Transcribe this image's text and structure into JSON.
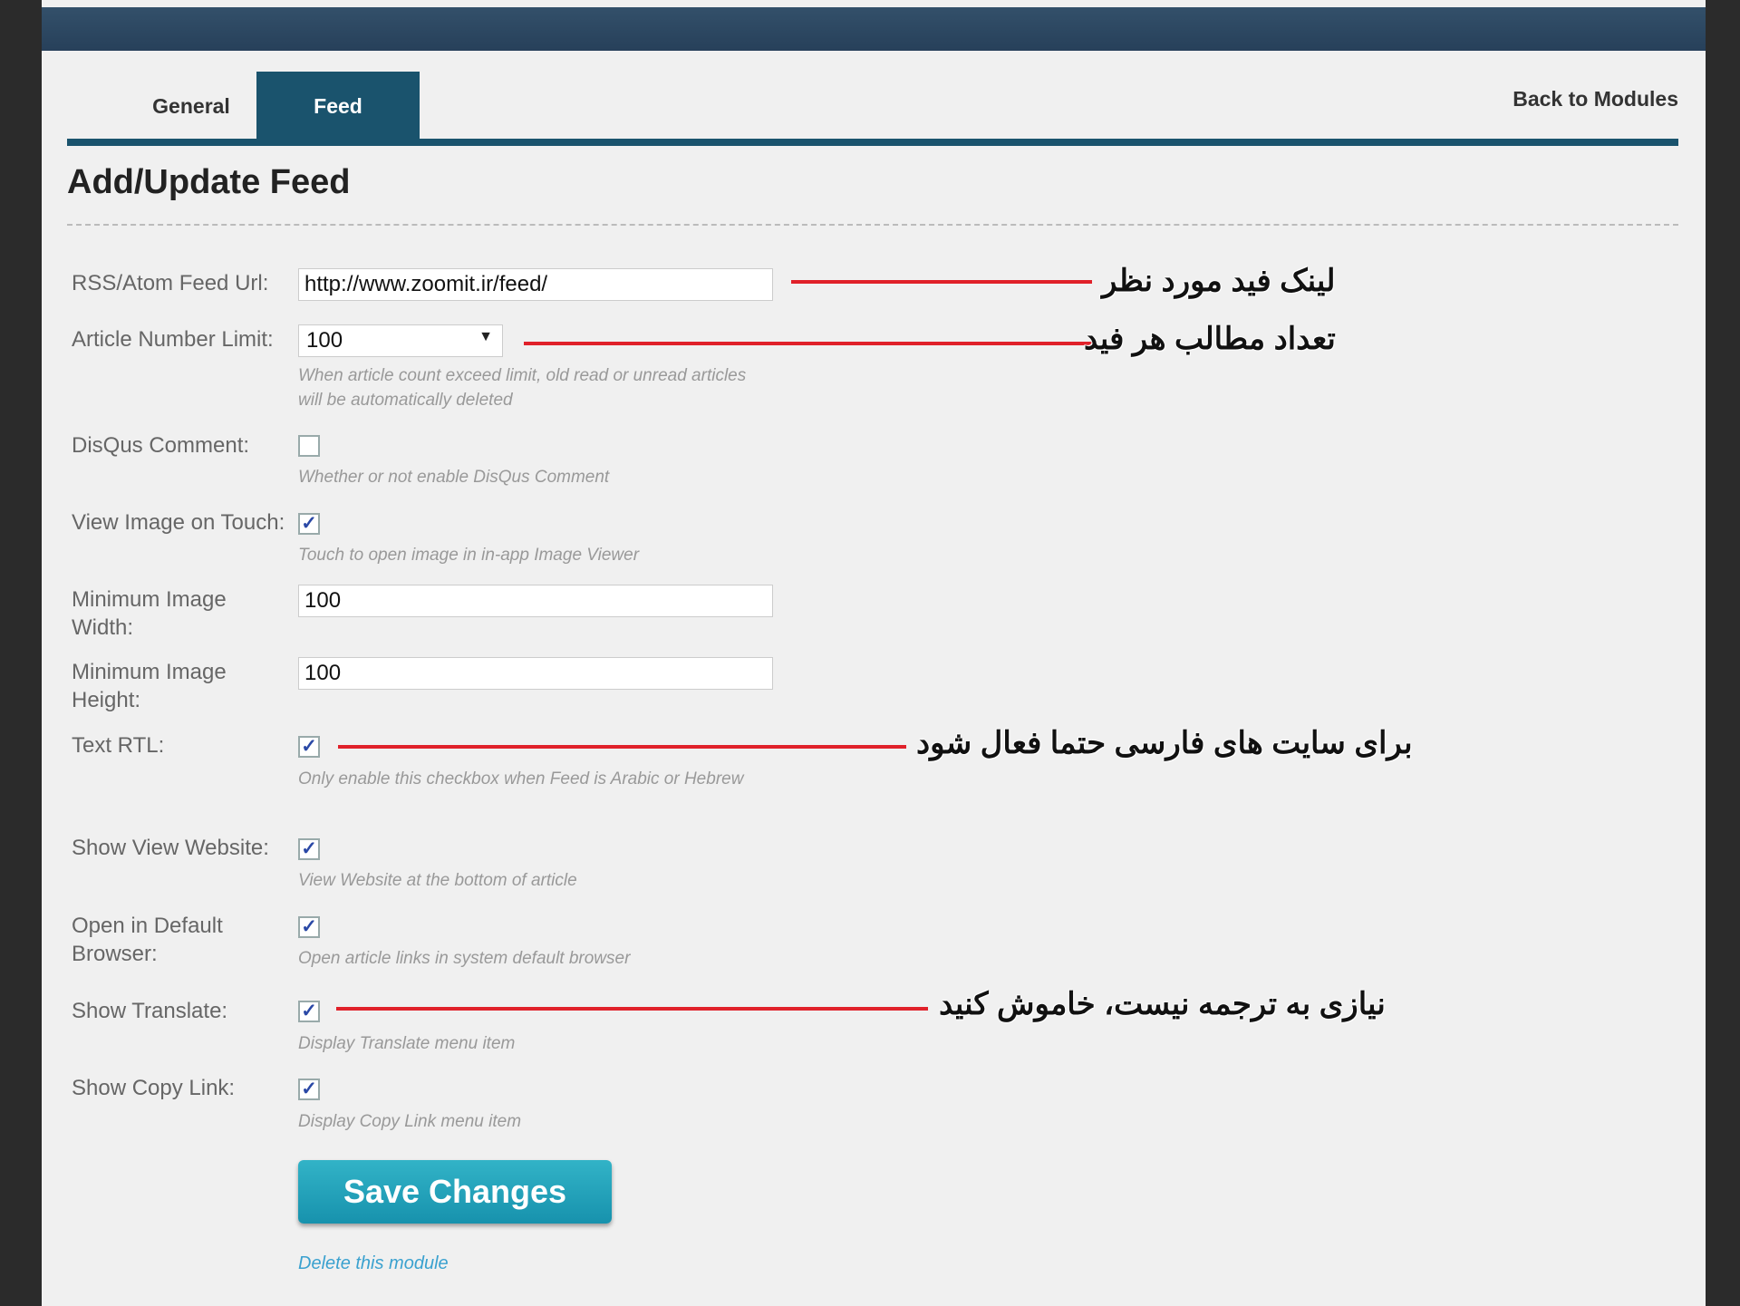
{
  "tabs": [
    {
      "label": "General"
    },
    {
      "label": "Feed"
    }
  ],
  "back_link": "Back to Modules",
  "page_title": "Add/Update Feed",
  "fields": {
    "feed_url": {
      "label": "RSS/Atom Feed Url:",
      "value": "http://www.zoomit.ir/feed/"
    },
    "article_limit": {
      "label": "Article Number Limit:",
      "value": "100",
      "help": "When article count exceed limit, old read or unread articles will be automatically deleted"
    },
    "disqus": {
      "label": "DisQus Comment:",
      "checked": false,
      "help": "Whether or not enable DisQus Comment"
    },
    "view_image": {
      "label": "View Image on Touch:",
      "checked": true,
      "help": "Touch to open image in in-app Image Viewer"
    },
    "min_width": {
      "label": "Minimum Image Width:",
      "value": "100"
    },
    "min_height": {
      "label": "Minimum Image Height:",
      "value": "100"
    },
    "text_rtl": {
      "label": "Text RTL:",
      "checked": true,
      "help": "Only enable this checkbox when Feed is Arabic or Hebrew"
    },
    "show_website": {
      "label": "Show View Website:",
      "checked": true,
      "help": "View Website at the bottom of article"
    },
    "open_browser": {
      "label": "Open in Default Browser:",
      "checked": true,
      "help": "Open article links in system default browser"
    },
    "show_translate": {
      "label": "Show Translate:",
      "checked": true,
      "help": "Display Translate menu item"
    },
    "show_copy": {
      "label": "Show Copy Link:",
      "checked": true,
      "help": "Display Copy Link menu item"
    }
  },
  "check_glyph": "✓",
  "annotations": {
    "feed_link": "لینک فید مورد نظر",
    "article_count": "تعداد مطالب هر فید",
    "rtl_note": "برای سایت های فارسی حتما فعال شود",
    "translate_note": "نیازی به ترجمه نیست، خاموش کنید"
  },
  "save_button": "Save Changes",
  "delete_link": "Delete this module",
  "colors": {
    "accent": "#1a536d",
    "button": "#1fa3bb",
    "annotation_line": "#e0212a",
    "link": "#3aa1cf"
  }
}
